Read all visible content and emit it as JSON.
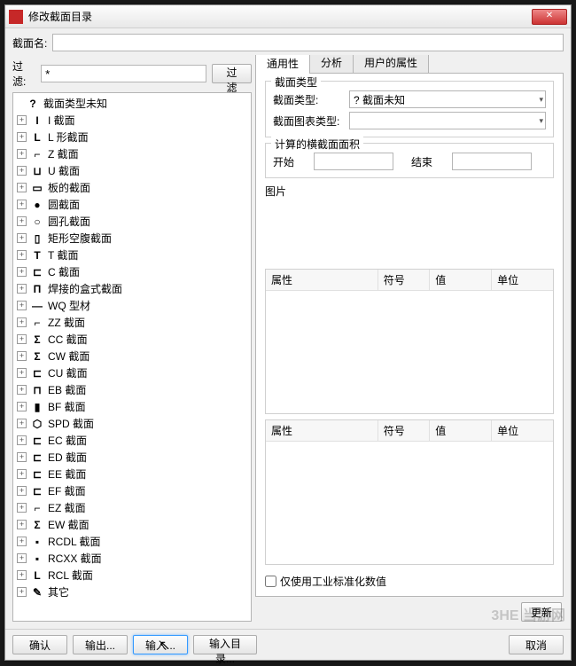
{
  "window": {
    "title": "修改截面目录",
    "close": "✕"
  },
  "section_name_label": "截面名:",
  "section_name_value": "",
  "filter": {
    "label": "过滤:",
    "value": "*",
    "button": "过滤"
  },
  "tree": [
    {
      "icon": "?",
      "label": "截面类型未知",
      "expandable": false,
      "root": true
    },
    {
      "icon": "I",
      "label": "I 截面",
      "expandable": true
    },
    {
      "icon": "L",
      "label": "L 形截面",
      "expandable": true
    },
    {
      "icon": "⌐",
      "label": "Z 截面",
      "expandable": true
    },
    {
      "icon": "⊔",
      "label": "U 截面",
      "expandable": true
    },
    {
      "icon": "▭",
      "label": "板的截面",
      "expandable": true
    },
    {
      "icon": "●",
      "label": "圆截面",
      "expandable": true
    },
    {
      "icon": "○",
      "label": "圆孔截面",
      "expandable": true
    },
    {
      "icon": "▯",
      "label": "矩形空腹截面",
      "expandable": true
    },
    {
      "icon": "T",
      "label": "T 截面",
      "expandable": true
    },
    {
      "icon": "⊏",
      "label": "C 截面",
      "expandable": true
    },
    {
      "icon": "Π",
      "label": "焊接的盒式截面",
      "expandable": true
    },
    {
      "icon": "—",
      "label": "WQ 型材",
      "expandable": true
    },
    {
      "icon": "⌐",
      "label": "ZZ 截面",
      "expandable": true
    },
    {
      "icon": "Σ",
      "label": "CC 截面",
      "expandable": true
    },
    {
      "icon": "Σ",
      "label": "CW 截面",
      "expandable": true
    },
    {
      "icon": "⊏",
      "label": "CU 截面",
      "expandable": true
    },
    {
      "icon": "⊓",
      "label": "EB 截面",
      "expandable": true
    },
    {
      "icon": "▮",
      "label": "BF 截面",
      "expandable": true
    },
    {
      "icon": "⬡",
      "label": "SPD 截面",
      "expandable": true
    },
    {
      "icon": "⊏",
      "label": "EC 截面",
      "expandable": true
    },
    {
      "icon": "⊏",
      "label": "ED 截面",
      "expandable": true
    },
    {
      "icon": "⊏",
      "label": "EE 截面",
      "expandable": true
    },
    {
      "icon": "⊏",
      "label": "EF 截面",
      "expandable": true
    },
    {
      "icon": "⌐",
      "label": "EZ 截面",
      "expandable": true
    },
    {
      "icon": "Σ",
      "label": "EW 截面",
      "expandable": true
    },
    {
      "icon": "▪",
      "label": "RCDL 截面",
      "expandable": true
    },
    {
      "icon": "▪",
      "label": "RCXX 截面",
      "expandable": true
    },
    {
      "icon": "L",
      "label": "RCL 截面",
      "expandable": true
    },
    {
      "icon": "✎",
      "label": "其它",
      "expandable": true
    }
  ],
  "tabs": [
    {
      "id": "general",
      "label": "通用性",
      "active": true
    },
    {
      "id": "analysis",
      "label": "分析",
      "active": false
    },
    {
      "id": "userattr",
      "label": "用户的属性",
      "active": false
    }
  ],
  "right": {
    "group_type": {
      "title": "截面类型",
      "type_label": "截面类型:",
      "type_value": "? 截面未知",
      "chart_label": "截面图表类型:",
      "chart_value": ""
    },
    "group_area": {
      "title": "计算的横截面面积",
      "start_label": "开始",
      "start_value": "",
      "end_label": "结束",
      "end_value": ""
    },
    "picture_label": "图片",
    "table_headers": {
      "property": "属性",
      "symbol": "符号",
      "value": "值",
      "unit": "单位"
    },
    "only_standard_checkbox": "仅使用工业标准化数值",
    "only_standard_checked": false,
    "update_button": "更新"
  },
  "bottom": {
    "ok": "确认",
    "export": "输出...",
    "import": "输入...",
    "import_dir": "输入目录...",
    "cancel": "取消"
  },
  "watermark": "3HE 当游网"
}
